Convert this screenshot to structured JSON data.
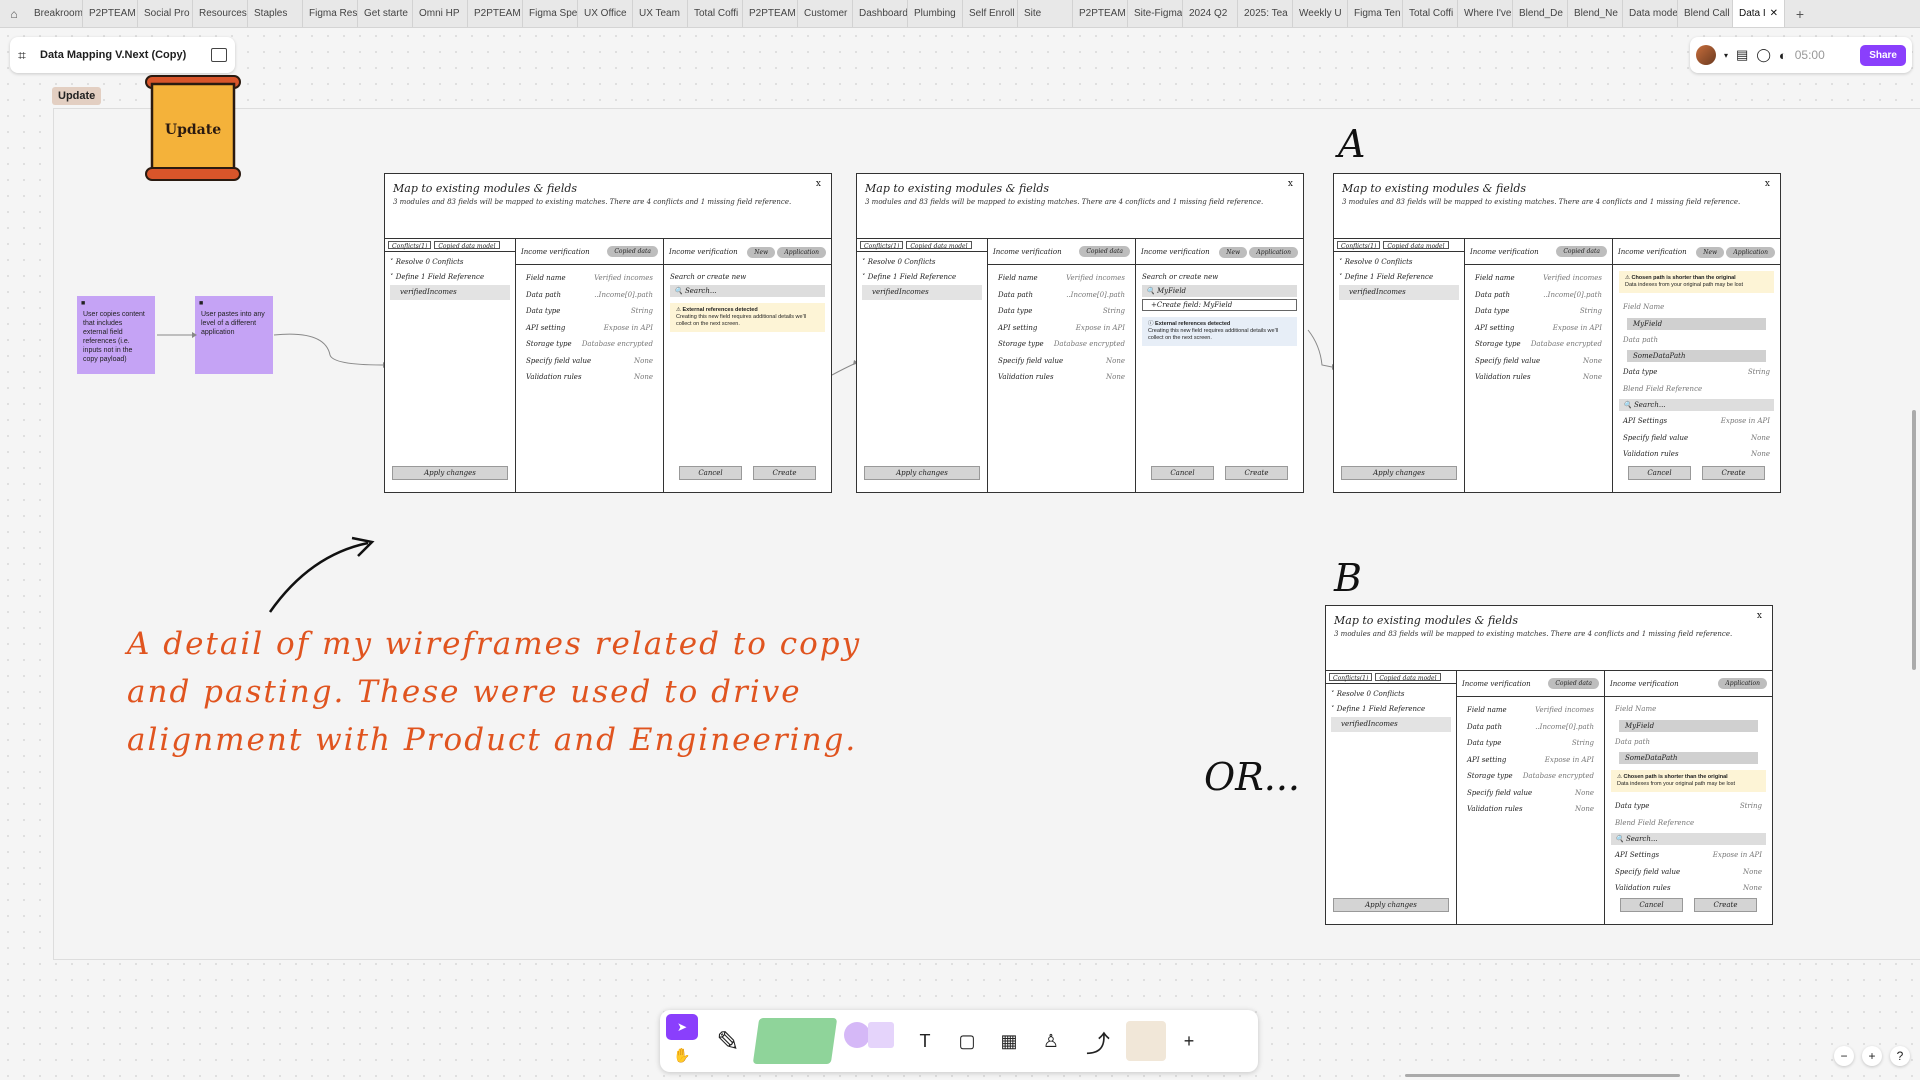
{
  "tabs": [
    "Breakroom",
    "P2PTEAM",
    "Social Pro",
    "Resources",
    "Staples",
    "Figma Res",
    "Get starte",
    "Omni HP",
    "P2PTEAM",
    "Figma Spe",
    "UX Office",
    "UX Team",
    "Total Coffi",
    "P2PTEAM",
    "Customer",
    "Dashboard",
    "Plumbing",
    "Self Enroll",
    "Site",
    "P2PTEAM",
    "Site-Figma",
    "2024 Q2",
    "2025: Tea",
    "Weekly U",
    "Figma Ten",
    "Total Coffi",
    "Where I've",
    "Blend_De",
    "Blend_Ne",
    "Data mode",
    "Blend Call"
  ],
  "active_tab": "Data I",
  "file_name": "Data Mapping V.Next (Copy)",
  "timer": "05:00",
  "share_label": "Share",
  "section_label": "Update",
  "scroll_sign": "Update",
  "stickies": [
    "User copies content that includes external field references (i.e. inputs not in the copy payload)",
    "User pastes into any level of a different application"
  ],
  "letters": {
    "a": "A",
    "b": "B",
    "or": "OR..."
  },
  "note": "A detail of my wireframes related to copy and pasting. These were used to drive alignment with Product and Engineering.",
  "wireframe": {
    "title": "Map to existing modules & fields",
    "subtitle": "3 modules and 83 fields will be mapped to existing matches. There are 4 conflicts and 1 missing field reference.",
    "close": "x",
    "tab_conflicts": "Conflicts(1)",
    "tab_copied": "Copied data model",
    "tree": [
      "Resolve 0 Conflicts",
      "Define 1 Field Reference",
      "verifiedIncomes"
    ],
    "apply": "Apply changes",
    "col2_header": "Income verification",
    "copied_data": "Copied data",
    "col3_header": "Income verification",
    "new": "New",
    "application": "Application",
    "fields": [
      [
        "Field name",
        "Verified incomes"
      ],
      [
        "Data path",
        "..Income[0].path"
      ],
      [
        "Data type",
        "String"
      ],
      [
        "API setting",
        "Expose in API"
      ],
      [
        "Storage type",
        "Database encrypted"
      ],
      [
        "Specify field value",
        "None"
      ],
      [
        "Validation rules",
        "None"
      ]
    ],
    "search_or_create": "Search or create new",
    "search": "Search...",
    "ext_warning": "External references detected",
    "ext_warning_detail": "Creating this new field requires additional details we'll collect on the next screen.",
    "typed": "MyField",
    "create_field": "+Create field: MyField",
    "cancel": "Cancel",
    "create": "Create",
    "short_path": "Chosen path is shorter than the original",
    "short_path_detail": "Data indexes from your original path may be lost",
    "field_name_label": "Field Name",
    "field_name_value": "MyField",
    "data_path_label": "Data path",
    "data_path_value": "SomeDataPath",
    "data_type_label": "Data type",
    "data_type_value": "String",
    "blend_ref": "Blend Field Reference",
    "api_settings": "API Settings",
    "api_value": "Expose in API",
    "specify": "Specify field value",
    "specify_value": "None",
    "validation": "Validation rules",
    "validation_value": "None"
  },
  "toolbar_tools": [
    "move-tool",
    "hand-tool",
    "pen-tool",
    "section-tool",
    "shape-tool",
    "text-tool",
    "sticky-tool",
    "table-tool",
    "stamp-tool",
    "connector-tool",
    "templates-tool",
    "more-tool"
  ],
  "toolbar_labels": {
    "text": "T",
    "plus": "+"
  },
  "zoom": {
    "minus": "−",
    "plus": "+",
    "help": "?"
  }
}
